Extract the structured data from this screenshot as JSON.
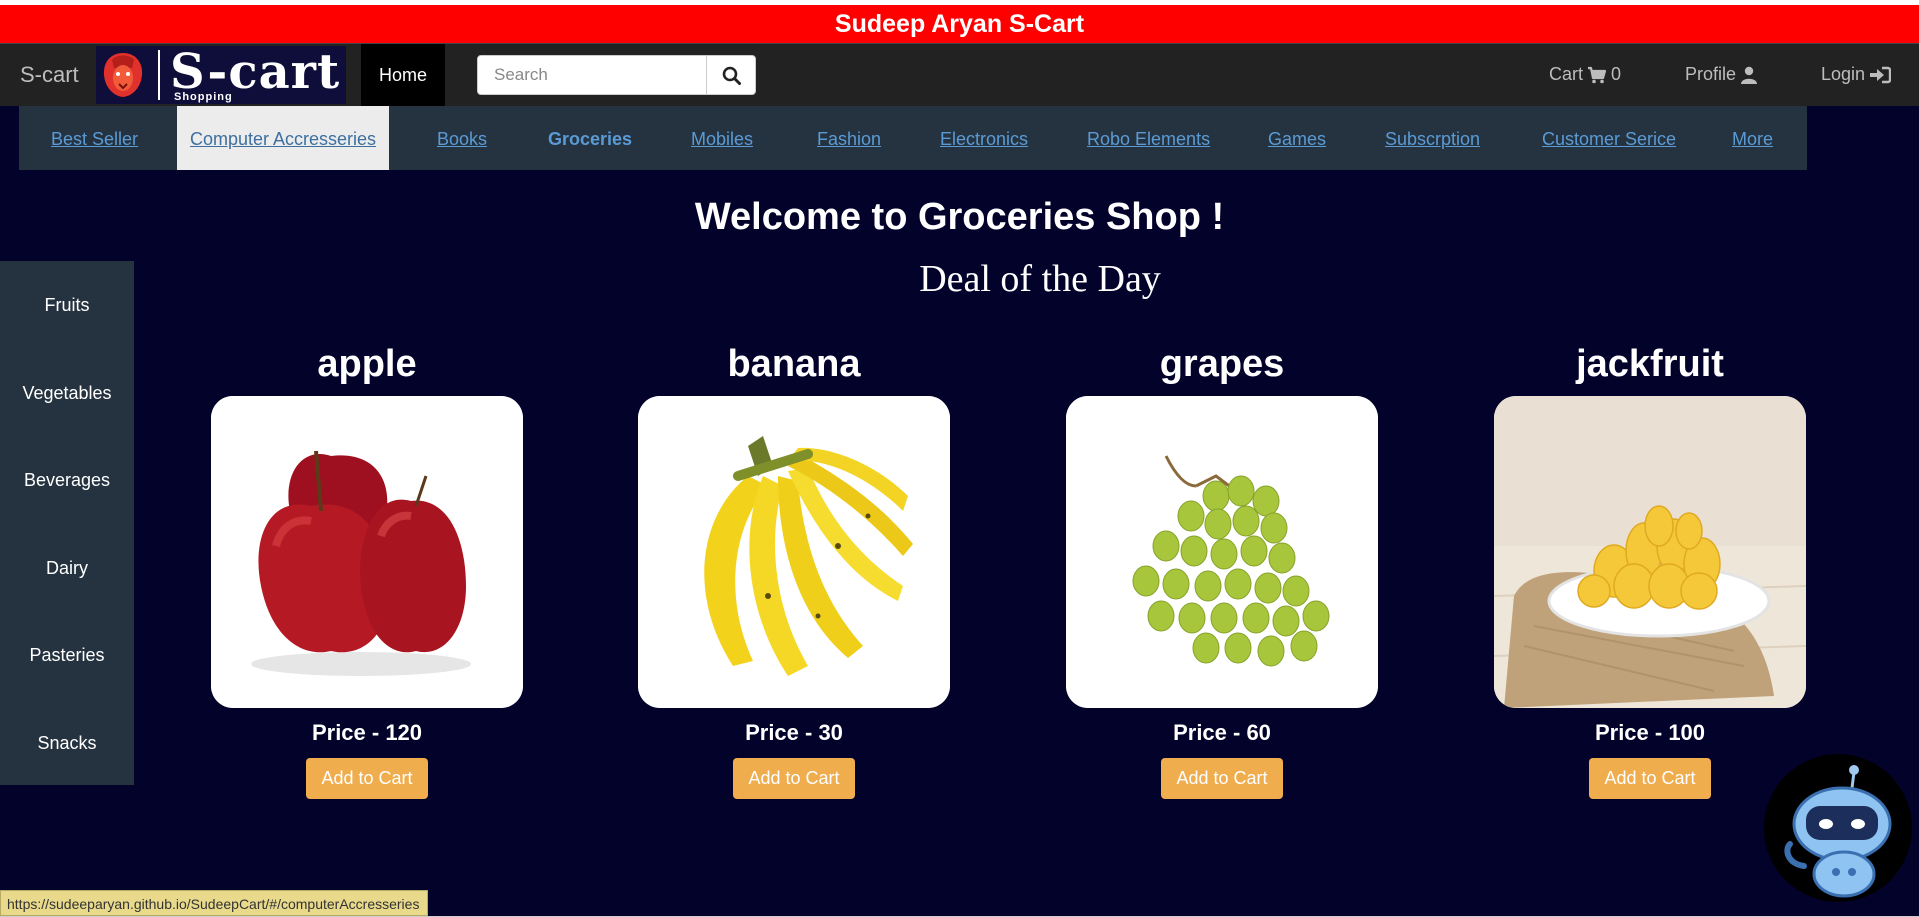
{
  "banner": {
    "title": "Sudeep Aryan S-Cart"
  },
  "navbar": {
    "brand": "S-cart",
    "logo_word": "S-cart",
    "logo_sub": "Shopping",
    "home": "Home",
    "search_placeholder": "Search",
    "cart_label": "Cart",
    "cart_count": "0",
    "profile_label": "Profile",
    "login_label": "Login",
    "icons": {
      "search": "search-icon",
      "cart": "cart-icon",
      "profile": "user-icon",
      "login": "sign-in-icon"
    }
  },
  "categories": [
    {
      "label": "Best Seller"
    },
    {
      "label": "Computer Accresseries"
    },
    {
      "label": "Books"
    },
    {
      "label": "Groceries"
    },
    {
      "label": "Mobiles"
    },
    {
      "label": "Fashion"
    },
    {
      "label": "Electronics"
    },
    {
      "label": "Robo Elements"
    },
    {
      "label": "Games"
    },
    {
      "label": "Subscrption"
    },
    {
      "label": "Customer Serice"
    },
    {
      "label": "More"
    }
  ],
  "main": {
    "welcome": "Welcome to Groceries Shop !",
    "deal": "Deal of the Day"
  },
  "sidebar": {
    "items": [
      {
        "label": "Fruits"
      },
      {
        "label": "Vegetables"
      },
      {
        "label": "Beverages"
      },
      {
        "label": "Dairy"
      },
      {
        "label": "Pasteries"
      },
      {
        "label": "Snacks"
      }
    ]
  },
  "products": [
    {
      "name": "apple",
      "price": "Price - 120",
      "button": "Add to Cart"
    },
    {
      "name": "banana",
      "price": "Price - 30",
      "button": "Add to Cart"
    },
    {
      "name": "grapes",
      "price": "Price - 60",
      "button": "Add to Cart"
    },
    {
      "name": "jackfruit",
      "price": "Price - 100",
      "button": "Add to Cart"
    }
  ],
  "status_bar": {
    "url": "https://sudeeparyan.github.io/SudeepCart/#/computerAccresseries"
  },
  "colors": {
    "banner": "#ff0000",
    "navbar": "#222222",
    "page_bg": "#03022b",
    "category_bar": "#253340",
    "button": "#f0ad4e",
    "link": "#5b9bd5"
  }
}
